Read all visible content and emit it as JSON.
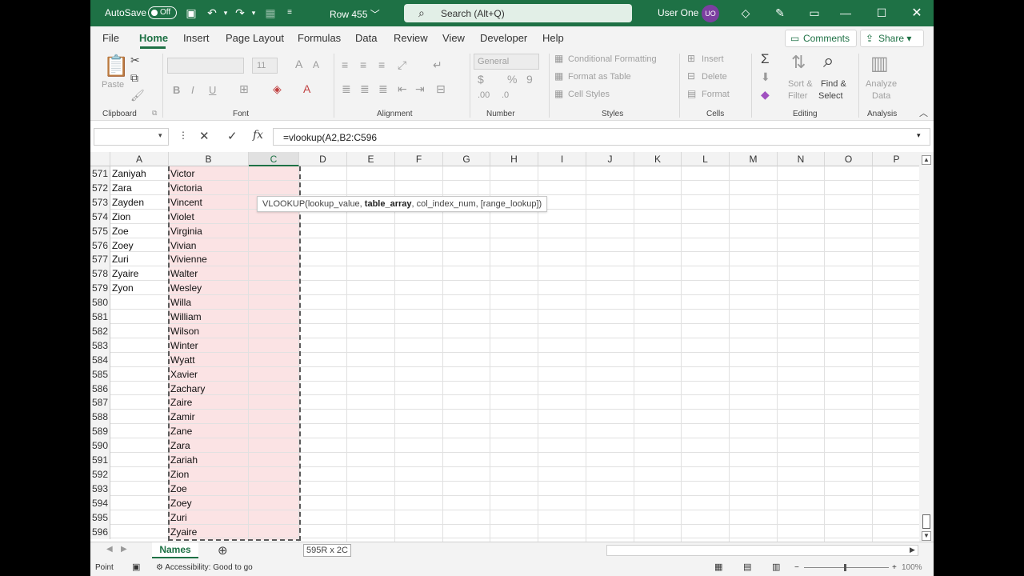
{
  "titlebar": {
    "autosave_label": "AutoSave",
    "autosave_state": "Off",
    "doc_name": "Row 455",
    "doc_chevron": "﹀",
    "search_placeholder": "Search (Alt+Q)",
    "user_name": "User One",
    "user_initials": "UO"
  },
  "tabs": [
    {
      "label": "File"
    },
    {
      "label": "Home"
    },
    {
      "label": "Insert"
    },
    {
      "label": "Page Layout"
    },
    {
      "label": "Formulas"
    },
    {
      "label": "Data"
    },
    {
      "label": "Review"
    },
    {
      "label": "View"
    },
    {
      "label": "Developer"
    },
    {
      "label": "Help"
    }
  ],
  "ribbon_actions": {
    "comments_label": "Comments",
    "share_label": "Share"
  },
  "ribbon": {
    "clipboard": {
      "paste": "Paste",
      "group": "Clipboard"
    },
    "font": {
      "group": "Font",
      "size": "11",
      "bold": "B",
      "italic": "I",
      "underline": "U"
    },
    "alignment": {
      "group": "Alignment"
    },
    "number": {
      "group": "Number",
      "format": "General",
      "percent": "%",
      "comma": "9"
    },
    "styles": {
      "group": "Styles",
      "conditional": "Conditional Formatting",
      "format_table": "Format as Table",
      "cell_styles": "Cell Styles"
    },
    "cells": {
      "group": "Cells",
      "insert": "Insert",
      "delete": "Delete",
      "format": "Format"
    },
    "editing": {
      "group": "Editing",
      "sort_l1": "Sort &",
      "sort_l2": "Filter",
      "find_l1": "Find &",
      "find_l2": "Select"
    },
    "analysis": {
      "group": "Analysis",
      "analyze_l1": "Analyze",
      "analyze_l2": "Data"
    }
  },
  "formula_bar": {
    "formula": "=vlookup(A2,B2:C596",
    "fx": "fx"
  },
  "columns": [
    "A",
    "B",
    "C",
    "D",
    "E",
    "F",
    "G",
    "H",
    "I",
    "J",
    "K",
    "L",
    "M",
    "N",
    "O",
    "P"
  ],
  "rows": [
    {
      "num": "571",
      "a": "Zaniyah",
      "b": "Victor"
    },
    {
      "num": "572",
      "a": "Zara",
      "b": "Victoria"
    },
    {
      "num": "573",
      "a": "Zayden",
      "b": "Vincent"
    },
    {
      "num": "574",
      "a": "Zion",
      "b": "Violet"
    },
    {
      "num": "575",
      "a": "Zoe",
      "b": "Virginia"
    },
    {
      "num": "576",
      "a": "Zoey",
      "b": "Vivian"
    },
    {
      "num": "577",
      "a": "Zuri",
      "b": "Vivienne"
    },
    {
      "num": "578",
      "a": "Zyaire",
      "b": "Walter"
    },
    {
      "num": "579",
      "a": "Zyon",
      "b": "Wesley"
    },
    {
      "num": "580",
      "a": "",
      "b": "Willa"
    },
    {
      "num": "581",
      "a": "",
      "b": "William"
    },
    {
      "num": "582",
      "a": "",
      "b": "Wilson"
    },
    {
      "num": "583",
      "a": "",
      "b": "Winter"
    },
    {
      "num": "584",
      "a": "",
      "b": "Wyatt"
    },
    {
      "num": "585",
      "a": "",
      "b": "Xavier"
    },
    {
      "num": "586",
      "a": "",
      "b": "Zachary"
    },
    {
      "num": "587",
      "a": "",
      "b": "Zaire"
    },
    {
      "num": "588",
      "a": "",
      "b": "Zamir"
    },
    {
      "num": "589",
      "a": "",
      "b": "Zane"
    },
    {
      "num": "590",
      "a": "",
      "b": "Zara"
    },
    {
      "num": "591",
      "a": "",
      "b": "Zariah"
    },
    {
      "num": "592",
      "a": "",
      "b": "Zion"
    },
    {
      "num": "593",
      "a": "",
      "b": "Zoe"
    },
    {
      "num": "594",
      "a": "",
      "b": "Zoey"
    },
    {
      "num": "595",
      "a": "",
      "b": "Zuri"
    },
    {
      "num": "596",
      "a": "",
      "b": "Zyaire"
    }
  ],
  "tooltip": {
    "fn": "VLOOKUP(lookup_value, ",
    "bold_arg": "table_array",
    "rest": ", col_index_num, [range_lookup])"
  },
  "sheet": {
    "name": "Names",
    "selection_size": "595R x 2C"
  },
  "status": {
    "mode": "Point",
    "accessibility": "Accessibility: Good to go",
    "zoom": "100%"
  },
  "colors": {
    "brand": "#1e7145",
    "range_fill": "#fbe3e4",
    "avatar": "#7b3fa0"
  }
}
